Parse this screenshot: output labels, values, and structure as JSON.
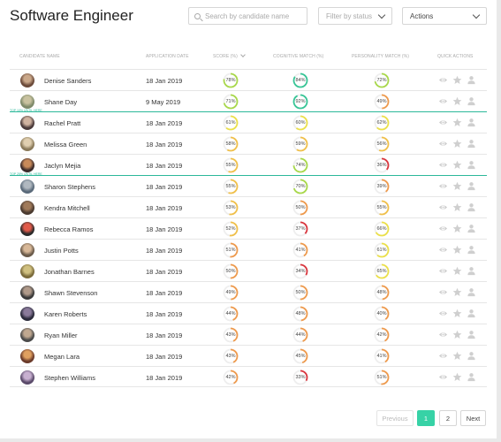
{
  "header": {
    "title": "Software Engineer",
    "search_placeholder": "Search by candidate name",
    "filter_label": "Filter by status",
    "actions_label": "Actions"
  },
  "columns": {
    "candidate": "Candidate name",
    "date": "Application date",
    "score": "Score (%)",
    "cognitive": "Cognitive match (%)",
    "personality": "Personality match (%)",
    "quick": "Quick actions"
  },
  "dividers": {
    "top10": "Top 10% until here",
    "top25": "Top 25% until here"
  },
  "colors": {
    "accent": "#37d2a6",
    "divider": "#2cb89a",
    "gauge_red": "#d9363e",
    "gauge_orange": "#ee9a4d",
    "gauge_yellow": "#ebe04a",
    "gauge_green": "#37c596"
  },
  "icons": [
    "search-icon",
    "chevron-down-icon",
    "eye-icon",
    "star-icon",
    "user-icon"
  ],
  "candidates": [
    {
      "name": "Denise Sanders",
      "date": "18 Jan 2019",
      "score": "78",
      "cognitive": "84",
      "personality": "72"
    },
    {
      "name": "Shane Day",
      "date": "9 May 2019",
      "score": "71",
      "cognitive": "92",
      "personality": "49"
    },
    {
      "name": "Rachel Pratt",
      "date": "18 Jan 2019",
      "score": "61",
      "cognitive": "60",
      "personality": "62"
    },
    {
      "name": "Melissa Green",
      "date": "18 Jan 2019",
      "score": "58",
      "cognitive": "59",
      "personality": "56"
    },
    {
      "name": "Jaclyn Mejia",
      "date": "18 Jan 2019",
      "score": "55",
      "cognitive": "74",
      "personality": "36"
    },
    {
      "name": "Sharon Stephens",
      "date": "18 Jan 2019",
      "score": "55",
      "cognitive": "70",
      "personality": "39"
    },
    {
      "name": "Kendra Mitchell",
      "date": "18 Jan 2019",
      "score": "53",
      "cognitive": "50",
      "personality": "55"
    },
    {
      "name": "Rebecca Ramos",
      "date": "18 Jan 2019",
      "score": "52",
      "cognitive": "37",
      "personality": "66"
    },
    {
      "name": "Justin Potts",
      "date": "18 Jan 2019",
      "score": "51",
      "cognitive": "41",
      "personality": "61"
    },
    {
      "name": "Jonathan Barnes",
      "date": "18 Jan 2019",
      "score": "50",
      "cognitive": "34",
      "personality": "65"
    },
    {
      "name": "Shawn Stevenson",
      "date": "18 Jan 2019",
      "score": "49",
      "cognitive": "50",
      "personality": "48"
    },
    {
      "name": "Karen Roberts",
      "date": "18 Jan 2019",
      "score": "44",
      "cognitive": "48",
      "personality": "40"
    },
    {
      "name": "Ryan Miller",
      "date": "18 Jan 2019",
      "score": "43",
      "cognitive": "44",
      "personality": "42"
    },
    {
      "name": "Megan Lara",
      "date": "18 Jan 2019",
      "score": "43",
      "cognitive": "45",
      "personality": "41"
    },
    {
      "name": "Stephen Williams",
      "date": "18 Jan 2019",
      "score": "42",
      "cognitive": "33",
      "personality": "51"
    }
  ],
  "pagination": {
    "previous": "Previous",
    "pages": [
      "1",
      "2"
    ],
    "next": "Next",
    "current": "1"
  }
}
